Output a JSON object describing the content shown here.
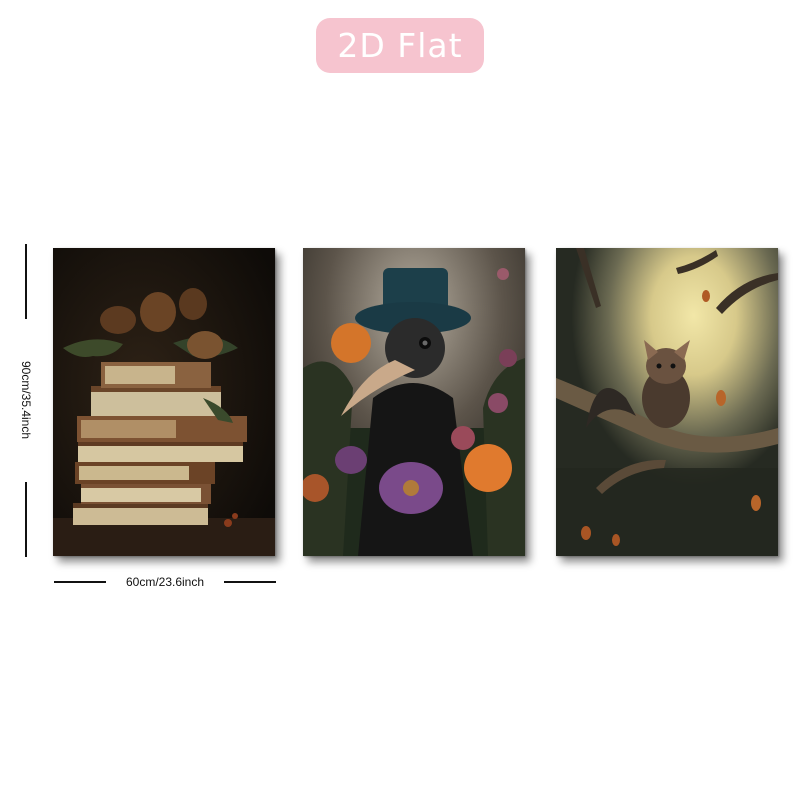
{
  "badge": {
    "label": "2D Flat",
    "color": "#f6c4cf"
  },
  "dimensions": {
    "height_label": "90cm/35.4inch",
    "width_label": "60cm/23.6inch"
  },
  "panels": [
    {
      "subject": "stack-of-old-books-with-pinecones"
    },
    {
      "subject": "plague-doctor-bird-in-top-hat-with-flowers"
    },
    {
      "subject": "bat-on-branch-under-full-moon"
    }
  ]
}
